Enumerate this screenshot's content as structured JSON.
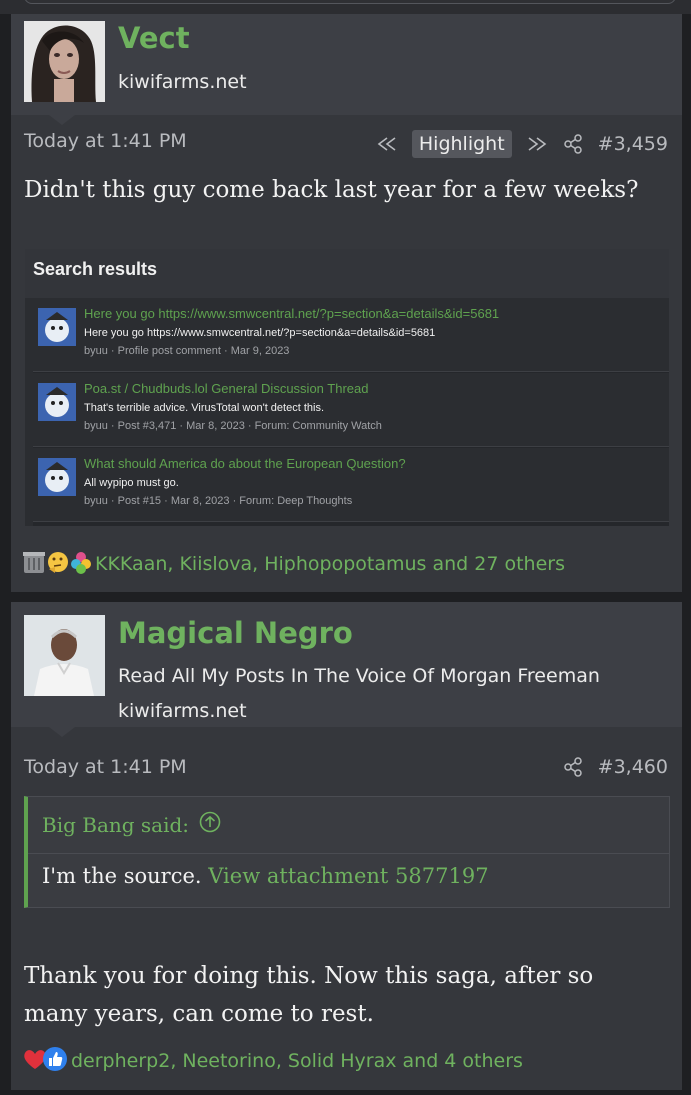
{
  "post1": {
    "username": "Vect",
    "user_title": "kiwifarms.net",
    "timestamp": "Today at 1:41 PM",
    "highlight_label": "Highlight",
    "post_number": "#3,459",
    "text": "Didn't this guy come back last year for a few weeks?",
    "search": {
      "title": "Search results",
      "results": [
        {
          "link": "Here you go https://www.smwcentral.net/?p=section&a=details&id=5681",
          "snippet": "Here you go https://www.smwcentral.net/?p=section&a=details&id=5681",
          "meta": "byuu · Profile post comment · Mar 9, 2023"
        },
        {
          "link": "Poa.st / Chudbuds.lol General Discussion Thread",
          "snippet": "That's terrible advice. VirusTotal won't detect this.",
          "meta": "byuu · Post #3,471 · Mar 8, 2023 · Forum: Community Watch"
        },
        {
          "link": "What should America do about the European Question?",
          "snippet": "All wypipo must go.",
          "meta": "byuu · Post #15 · Mar 8, 2023 · Forum: Deep Thoughts"
        }
      ]
    },
    "reactions": "KKKaan, Kiislova, Hiphopopotamus and 27 others"
  },
  "post2": {
    "username": "Magical Negro",
    "user_title_1": "Read All My Posts In The Voice Of Morgan Freeman",
    "user_title_2": "kiwifarms.net",
    "timestamp": "Today at 1:41 PM",
    "post_number": "#3,460",
    "quote": {
      "author": "Big Bang said:",
      "text": "I'm the source.",
      "attachment": "View attachment 5877197"
    },
    "text_line1": "Thank you for doing this. Now this saga, after so",
    "text_line2": "many years, can come to rest.",
    "reactions": "derpherp2, Neetorino, Solid Hyrax and 4 others"
  },
  "colors": {
    "accent_green": "#6fb25f",
    "background": "#1e1f22",
    "post_bg": "#35373c",
    "header_bg": "#3d3f45"
  }
}
